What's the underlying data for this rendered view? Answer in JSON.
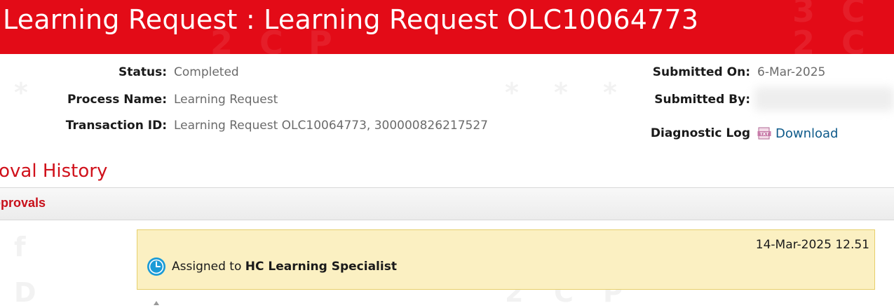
{
  "header": {
    "title": "Learning Request : Learning Request OLC10064773"
  },
  "details_left": {
    "status_label": "Status:",
    "status_value": "Completed",
    "process_label": "Process Name:",
    "process_value": "Learning Request",
    "transaction_label": "Transaction ID:",
    "transaction_value": "Learning Request OLC10064773, 300000826217527"
  },
  "details_right": {
    "submitted_on_label": "Submitted On:",
    "submitted_on_value": "6-Mar-2025",
    "submitted_by_label": "Submitted By:",
    "diagnostic_label": "Diagnostic Log",
    "download_label": "Download",
    "download_icon": "txt-file-icon"
  },
  "approval_history": {
    "title": "roval History",
    "approvals_label": "pprovals",
    "entries": [
      {
        "date": "14-Mar-2025 12.51",
        "prefix": "Assigned to ",
        "assignee": "HC Learning Specialist",
        "icon": "clock-icon"
      }
    ]
  },
  "colors": {
    "header_bg": "#e30b17",
    "accent_red": "#d0111b",
    "link_blue": "#0e5a8a",
    "card_bg": "#fbf0c2",
    "card_border": "#e6cf6c",
    "clock_blue": "#1a9bd7"
  }
}
